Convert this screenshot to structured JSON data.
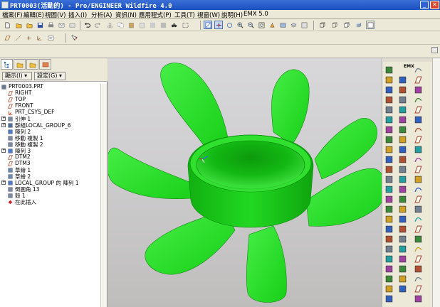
{
  "window": {
    "title": "PRT0003(活動的) - Pro/ENGINEER Wildfire 4.0",
    "minimize_glyph": "_",
    "close_glyph": "✕"
  },
  "menu": [
    "檔案(F)",
    "編輯(E)",
    "視圖(V)",
    "插入(I)",
    "分析(A)",
    "資訊(N)",
    "應用程式(P)",
    "工具(T)",
    "視窗(W)",
    "說明(H)",
    "EMX 5.0"
  ],
  "filters": {
    "show_label": "顯示(I) ▾",
    "settings_label": "設定(G) ▾"
  },
  "tree": [
    {
      "label": "PRT0003.PRT",
      "indent": 0,
      "icon": "part-icon",
      "color": "#6b7a8f"
    },
    {
      "label": "RIGHT",
      "indent": 1,
      "icon": "datum-plane-icon",
      "color": "#b05a3a"
    },
    {
      "label": "TOP",
      "indent": 1,
      "icon": "datum-plane-icon",
      "color": "#b05a3a"
    },
    {
      "label": "FRONT",
      "indent": 1,
      "icon": "datum-plane-icon",
      "color": "#b05a3a"
    },
    {
      "label": "PRT_CSYS_DEF",
      "indent": 1,
      "icon": "csys-icon",
      "color": "#c04020"
    },
    {
      "label": "引伸 1",
      "indent": 1,
      "icon": "extrude-icon",
      "color": "#7a8aa0",
      "expand": "+"
    },
    {
      "label": "群組LOCAL_GROUP_6",
      "indent": 1,
      "icon": "group-icon",
      "color": "#5070a0",
      "expand": "+"
    },
    {
      "label": "陣列 2",
      "indent": 1,
      "icon": "pattern-icon",
      "color": "#4a7bd0"
    },
    {
      "label": "移動 複製 1",
      "indent": 1,
      "icon": "move-copy-icon",
      "color": "#7a8aa0"
    },
    {
      "label": "移動 複製 2",
      "indent": 1,
      "icon": "move-copy-icon",
      "color": "#7a8aa0"
    },
    {
      "label": "陣列 3",
      "indent": 1,
      "icon": "pattern-icon",
      "color": "#4a7bd0",
      "expand": "+"
    },
    {
      "label": "DTM2",
      "indent": 1,
      "icon": "datum-plane-icon",
      "color": "#b05a3a"
    },
    {
      "label": "DTM3",
      "indent": 1,
      "icon": "datum-plane-icon",
      "color": "#b05a3a"
    },
    {
      "label": "草繪 1",
      "indent": 1,
      "icon": "sketch-icon",
      "color": "#6a8ab0"
    },
    {
      "label": "草繪 2",
      "indent": 1,
      "icon": "sketch-icon",
      "color": "#6a8ab0"
    },
    {
      "label": "LOCAL_GROUP 的 陣列 1",
      "indent": 1,
      "icon": "pattern-icon",
      "color": "#4a7bd0",
      "expand": "+"
    },
    {
      "label": "倒圓角 13",
      "indent": 1,
      "icon": "round-icon",
      "color": "#7a8aa0"
    },
    {
      "label": "殼 1",
      "indent": 1,
      "icon": "shell-icon",
      "color": "#7a8aa0"
    },
    {
      "label": "在此插入",
      "indent": 1,
      "icon": "insert-here-icon",
      "color": "#d02020"
    }
  ],
  "colors": {
    "model_green": "#1ed61e",
    "model_green_dark": "#0fa80f",
    "model_green_light": "#5cf05c",
    "model_edge": "#0b7d0b",
    "titlebar": "#2a5fd0"
  },
  "right_toolbar": {
    "emx_label": "EMX"
  }
}
